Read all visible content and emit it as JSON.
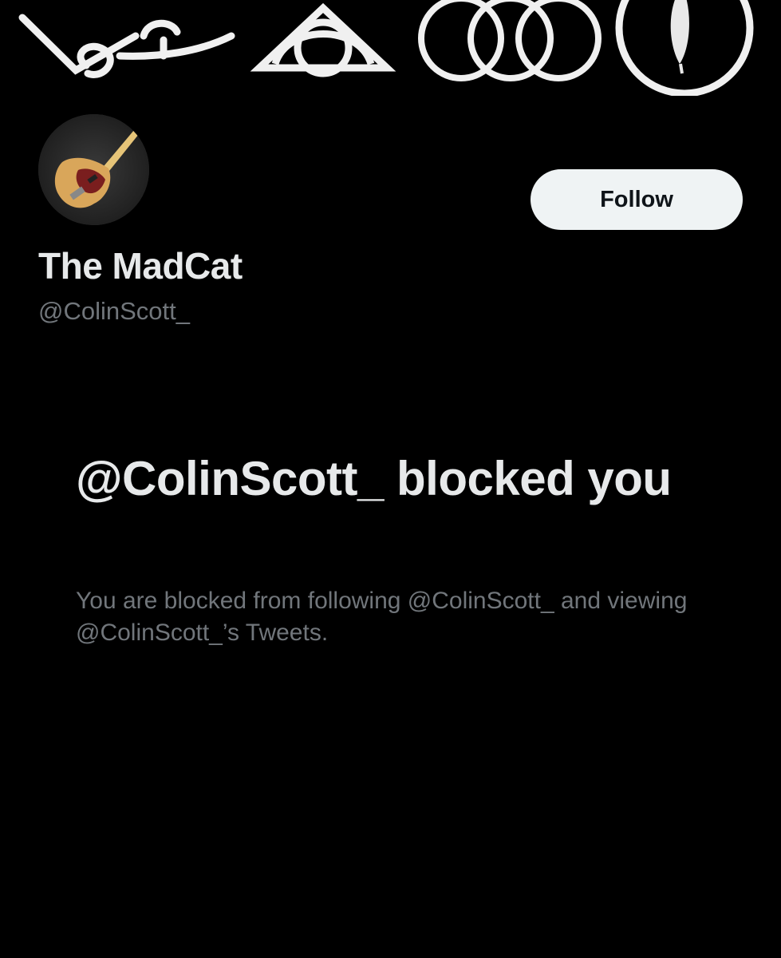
{
  "banner": {
    "icon_names": [
      "zoso-symbol-icon",
      "triquetra-symbol-icon",
      "borromean-rings-icon",
      "feather-circle-icon"
    ],
    "symbol_color": "#f0f0f0"
  },
  "profile": {
    "avatar_icon": "telecaster-guitar-avatar",
    "display_name": "The MadCat",
    "handle": "@ColinScott_",
    "follow_label": "Follow"
  },
  "blocked": {
    "title": "@ColinScott_ blocked you",
    "description": "You are blocked from following @ColinScott_ and viewing @ColinScott_’s Tweets."
  },
  "colors": {
    "background": "#000000",
    "primary_text": "#e7e9ea",
    "secondary_text": "#71767b",
    "follow_button_bg": "#eff3f4",
    "follow_button_text": "#0f1419"
  }
}
